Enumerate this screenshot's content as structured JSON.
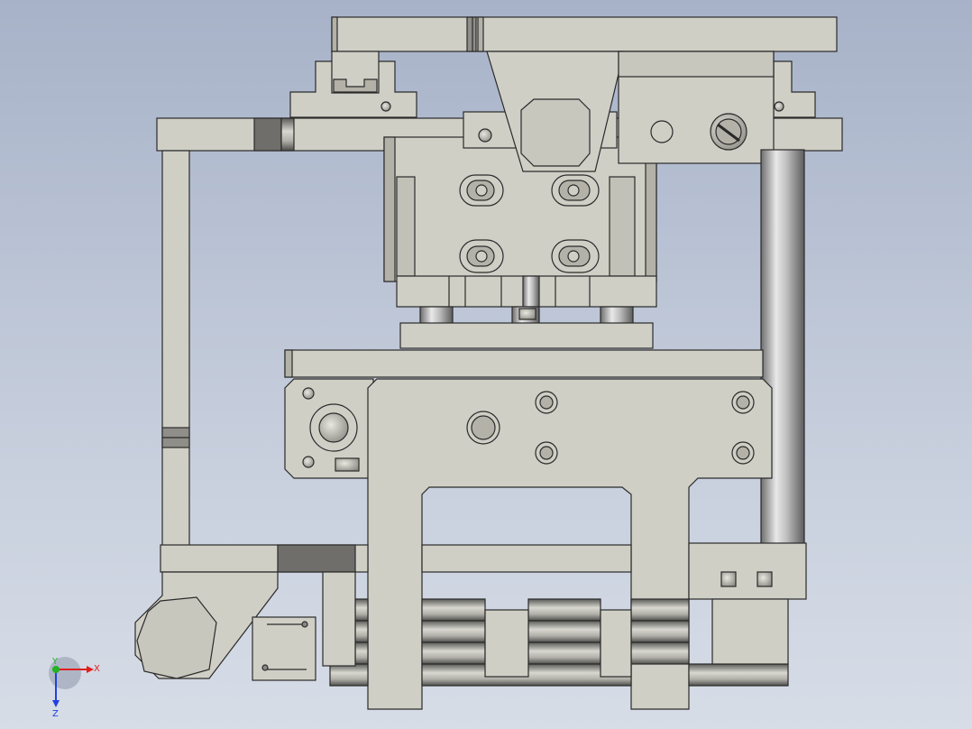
{
  "viewport": {
    "background_top": "#a7b2c8",
    "background_bottom": "#d7dde7",
    "part_fill": "#d0cfc6",
    "part_shade": "#b4b2a8",
    "edge_color": "#2a2a2a",
    "dark_face": "#6f6e6a"
  },
  "triad": {
    "x_label": "X",
    "y_label": "Y",
    "z_label": "Z",
    "x_color": "#e01f1f",
    "y_color": "#22b322",
    "z_color": "#2040e0"
  }
}
